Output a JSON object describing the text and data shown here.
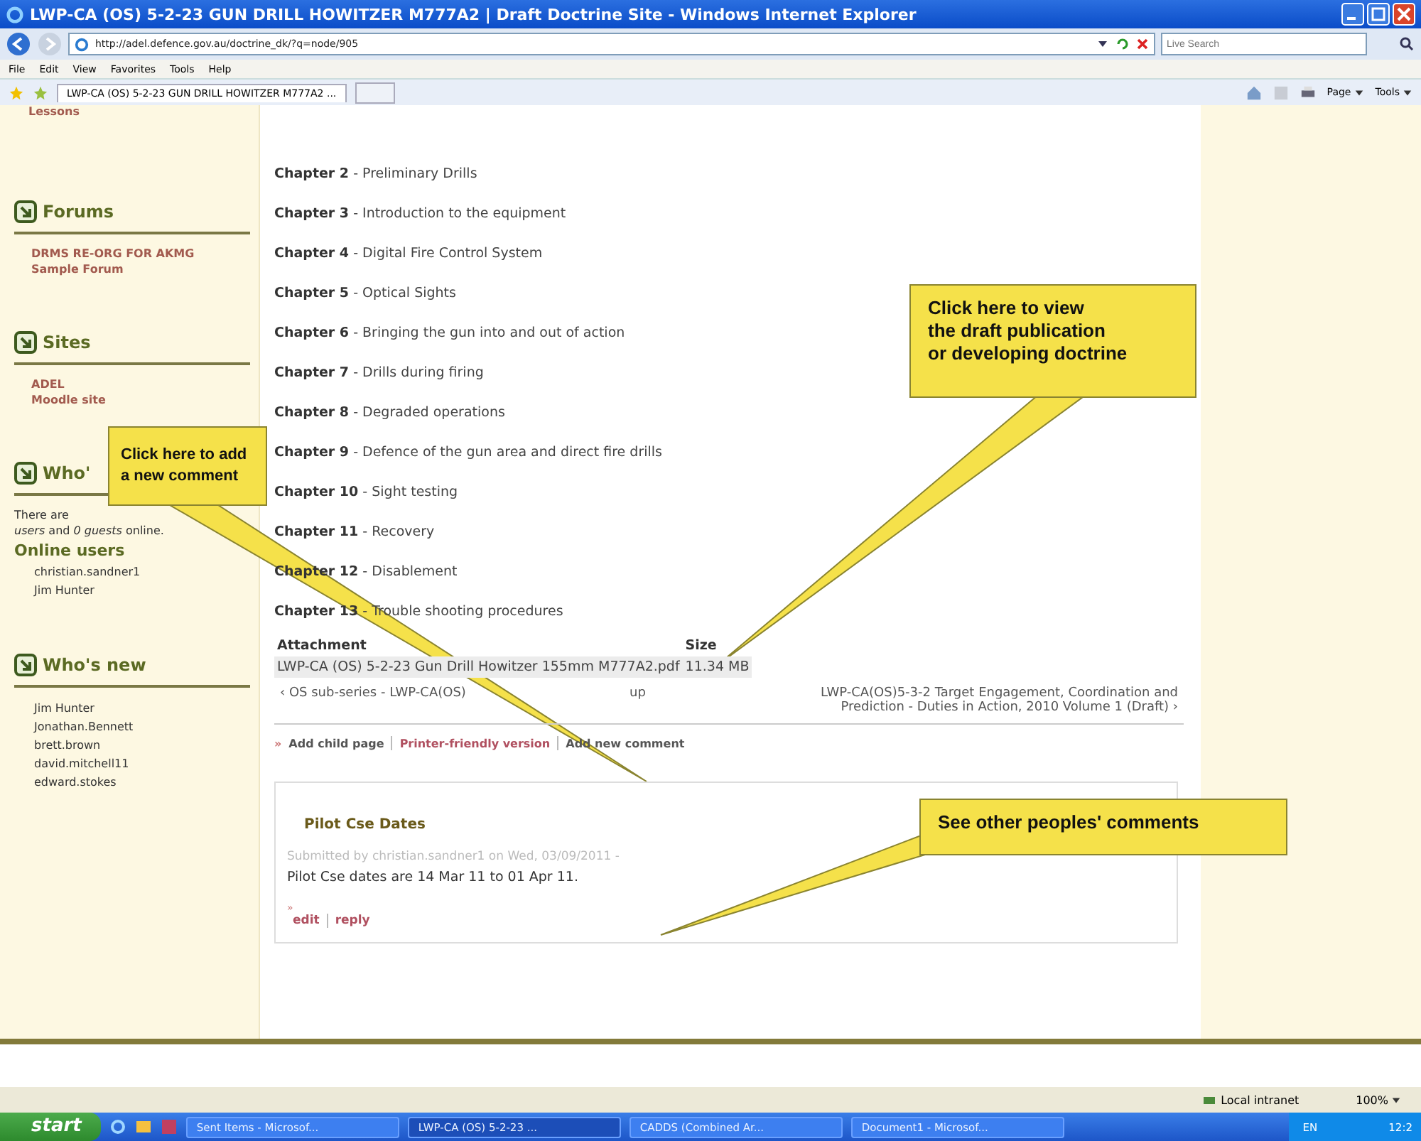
{
  "window": {
    "title": "LWP-CA (OS) 5-2-23 GUN DRILL HOWITZER M777A2 | Draft Doctrine Site - Windows Internet Explorer"
  },
  "address_bar": {
    "url": "http://adel.defence.gov.au/doctrine_dk/?q=node/905",
    "search_placeholder": "Live Search"
  },
  "menu": [
    "File",
    "Edit",
    "View",
    "Favorites",
    "Tools",
    "Help"
  ],
  "tabs": [
    {
      "label": "LWP-CA (OS) 5-2-23 GUN DRILL HOWITZER M777A2 ...",
      "selected": true
    }
  ],
  "toolbar": [
    "Page",
    "Tools"
  ],
  "sidebar": {
    "top_item": "Lessons",
    "blocks": [
      {
        "kind": "links",
        "title": "Forums",
        "items": [
          "DRMS RE-ORG FOR AKMG",
          "Sample Forum"
        ]
      },
      {
        "kind": "links",
        "title": "Sites",
        "items": [
          "ADEL",
          "Moodle site"
        ]
      },
      {
        "kind": "online",
        "title": "Who'",
        "text_lines": [
          "There are",
          "*users* and *0 guests* online."
        ],
        "subtitle": "Online users",
        "items": [
          "christian.sandner1",
          "Jim Hunter"
        ]
      },
      {
        "kind": "users",
        "title": "Who's new",
        "items": [
          "Jim Hunter",
          "Jonathan.Bennett",
          "brett.brown",
          "david.mitchell11",
          "edward.stokes"
        ]
      }
    ]
  },
  "chapters": [
    {
      "label": "Chapter 2",
      "title": "- Preliminary Drills"
    },
    {
      "label": "Chapter 3",
      "title": "-  Introduction to the equipment"
    },
    {
      "label": "Chapter 4",
      "title": "- Digital Fire Control System"
    },
    {
      "label": "Chapter 5",
      "title": "- Optical Sights"
    },
    {
      "label": "Chapter 6",
      "title": "- Bringing the gun into and out of action"
    },
    {
      "label": "Chapter 7",
      "title": "- Drills during firing"
    },
    {
      "label": "Chapter 8",
      "title": "- Degraded operations"
    },
    {
      "label": "Chapter 9",
      "title": "- Defence of the gun area and direct fire drills"
    },
    {
      "label": "Chapter 10",
      "title": "- Sight testing"
    },
    {
      "label": "Chapter 11",
      "title": "- Recovery"
    },
    {
      "label": "Chapter 12",
      "title": "- Disablement"
    },
    {
      "label": "Chapter 13",
      "title": "- Trouble shooting procedures"
    }
  ],
  "attachments": {
    "columns": [
      "Attachment",
      "Size"
    ],
    "rows": [
      {
        "file": "LWP-CA (OS) 5-2-23 Gun Drill Howitzer 155mm M777A2.pdf",
        "size": "11.34 MB"
      }
    ]
  },
  "book_nav": {
    "prev": "‹ OS sub-series - LWP-CA(OS)",
    "up": "up",
    "next": "LWP-CA(OS)5-3-2 Target Engagement, Coordination and Prediction - Duties in Action, 2010 Volume 1 (Draft) ›"
  },
  "links": {
    "marker": "»",
    "items": [
      {
        "label": "Add child page",
        "kind": "plain"
      },
      {
        "label": "Printer-friendly version",
        "kind": "accent"
      },
      {
        "label": "Add new comment",
        "kind": "plain"
      }
    ]
  },
  "comment": {
    "title": "Pilot Cse Dates",
    "meta": "Submitted by christian.sandner1 on Wed, 03/09/2011 -",
    "body": "Pilot Cse dates are 14 Mar 11 to 01 Apr 11.",
    "marker": "»",
    "links": [
      "edit",
      "reply"
    ]
  },
  "callouts": [
    {
      "text": "Click here to view\nthe draft publication\nor developing doctrine"
    },
    {
      "text": "Click here to add\na new comment"
    },
    {
      "text": "See other peoples' comments"
    }
  ],
  "status_bar": {
    "zone": "Local intranet",
    "zoom": "100%"
  },
  "taskbar": {
    "start": "start",
    "tasks": [
      {
        "label": "Sent Items - Microsof...",
        "selected": false
      },
      {
        "label": "LWP-CA (OS) 5-2-23 ...",
        "selected": true
      },
      {
        "label": "CADDS (Combined Ar...",
        "selected": false
      },
      {
        "label": "Document1 - Microsof...",
        "selected": false
      }
    ],
    "language": "EN",
    "clock": "12:2"
  }
}
